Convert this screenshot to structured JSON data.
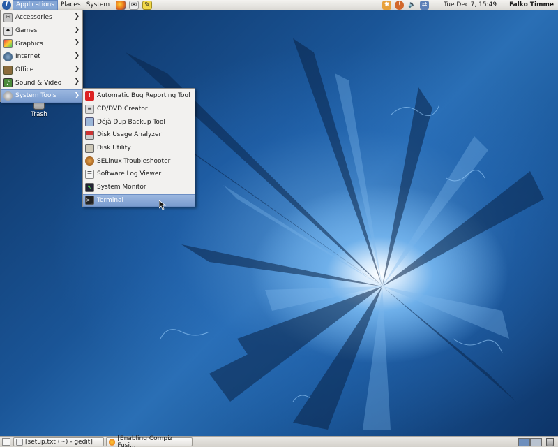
{
  "top_panel": {
    "menus": [
      "Applications",
      "Places",
      "System"
    ],
    "clock": "Tue Dec  7, 15:49",
    "user": "Falko Timme"
  },
  "desktop": {
    "icons": [
      {
        "label": "Trash",
        "icon": "trash-icon"
      }
    ]
  },
  "applications_menu": {
    "items": [
      {
        "label": "Accessories",
        "icon": "accessories-icon"
      },
      {
        "label": "Games",
        "icon": "games-icon"
      },
      {
        "label": "Graphics",
        "icon": "graphics-icon"
      },
      {
        "label": "Internet",
        "icon": "internet-icon"
      },
      {
        "label": "Office",
        "icon": "office-icon"
      },
      {
        "label": "Sound & Video",
        "icon": "sound-video-icon"
      },
      {
        "label": "System Tools",
        "icon": "system-tools-icon",
        "selected": true
      }
    ]
  },
  "system_tools_menu": {
    "items": [
      {
        "label": "Automatic Bug Reporting Tool",
        "icon": "bug-report-icon"
      },
      {
        "label": "CD/DVD Creator",
        "icon": "cd-dvd-icon"
      },
      {
        "label": "Déjà Dup Backup Tool",
        "icon": "backup-icon"
      },
      {
        "label": "Disk Usage Analyzer",
        "icon": "disk-usage-icon"
      },
      {
        "label": "Disk Utility",
        "icon": "disk-utility-icon"
      },
      {
        "label": "SELinux Troubleshooter",
        "icon": "selinux-icon"
      },
      {
        "label": "Software Log Viewer",
        "icon": "log-viewer-icon"
      },
      {
        "label": "System Monitor",
        "icon": "system-monitor-icon"
      },
      {
        "label": "Terminal",
        "icon": "terminal-icon",
        "selected": true
      }
    ]
  },
  "taskbar": {
    "tasks": [
      {
        "label": "[setup.txt (~) - gedit]",
        "icon": "gedit-icon"
      },
      {
        "label": "[Enabling Compiz Fusi...",
        "icon": "firefox-icon"
      }
    ],
    "workspaces": 2
  },
  "colors": {
    "selection": "#7a9ccf",
    "panel": "#dcdad5",
    "desktop": "#1a5597"
  }
}
